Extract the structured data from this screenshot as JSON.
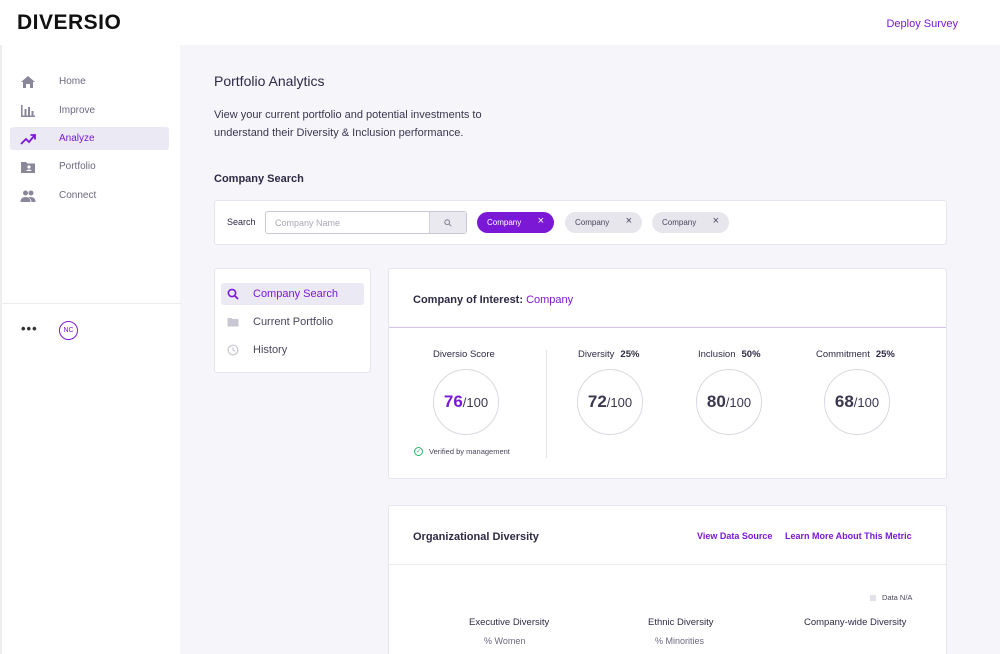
{
  "app": {
    "brand": "DIVERSIO",
    "deploy_label": "Deploy Survey"
  },
  "sidebar": {
    "items": [
      {
        "label": "Home",
        "icon": "home-icon",
        "active": false
      },
      {
        "label": "Improve",
        "icon": "bar-chart-icon",
        "active": false
      },
      {
        "label": "Analyze",
        "icon": "trend-line-icon",
        "active": true
      },
      {
        "label": "Portfolio",
        "icon": "id-card-icon",
        "active": false
      },
      {
        "label": "Connect",
        "icon": "people-icon",
        "active": false
      }
    ],
    "more_label": "•••",
    "avatar_initials": "NC"
  },
  "page": {
    "title": "Portfolio Analytics",
    "description": "View your current portfolio and potential investments to understand their Diversity & Inclusion performance."
  },
  "search": {
    "section_title": "Company Search",
    "label": "Search",
    "placeholder": "Company Name",
    "chips": [
      {
        "label": "Company",
        "selected": true
      },
      {
        "label": "Company",
        "selected": false
      },
      {
        "label": "Company",
        "selected": false
      }
    ]
  },
  "menu": {
    "items": [
      {
        "label": "Company Search",
        "icon": "search-icon",
        "active": true
      },
      {
        "label": "Current Portfolio",
        "icon": "folder-icon",
        "active": false
      },
      {
        "label": "History",
        "icon": "clock-icon",
        "active": false
      }
    ]
  },
  "interest": {
    "heading": "Company of Interest:",
    "company": "Company",
    "score": {
      "label": "Diversio Score",
      "value": "76",
      "max": "/100"
    },
    "verified_text": "Verified by management",
    "metrics": [
      {
        "label": "Diversity",
        "weight": "25%",
        "value": "72",
        "max": "/100"
      },
      {
        "label": "Inclusion",
        "weight": "50%",
        "value": "80",
        "max": "/100"
      },
      {
        "label": "Commitment",
        "weight": "25%",
        "value": "68",
        "max": "/100"
      }
    ]
  },
  "org": {
    "title": "Organizational Diversity",
    "link_source": "View Data Source",
    "link_learn": "Learn More About This Metric",
    "legend": "Data N/A",
    "columns": [
      {
        "title": "Executive Diversity",
        "subtitle": "% Women"
      },
      {
        "title": "Ethnic Diversity",
        "subtitle": "% Minorities"
      },
      {
        "title": "Company-wide Diversity",
        "subtitle": ""
      }
    ]
  },
  "colors": {
    "accent": "#7b18d6",
    "verified": "#2db46a"
  }
}
